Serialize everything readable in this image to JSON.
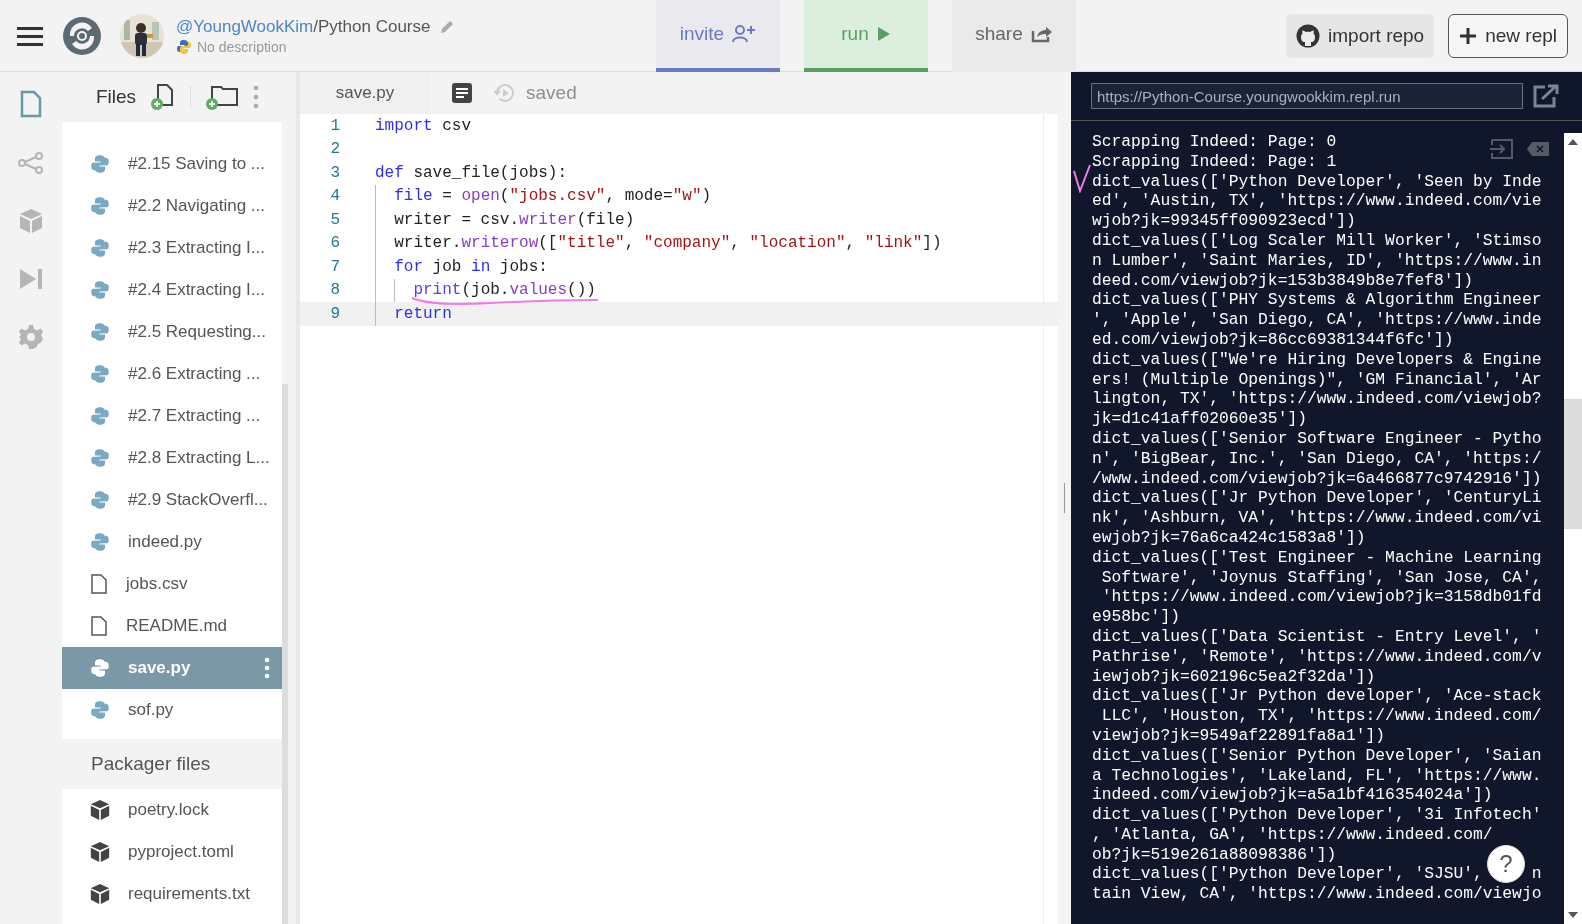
{
  "header": {
    "owner": "@YoungWookKim",
    "separator": "/",
    "project": "Python Course",
    "description": "No description"
  },
  "actions": [
    {
      "label": "invite",
      "kind": "invite"
    },
    {
      "label": "run",
      "kind": "run"
    },
    {
      "label": "share",
      "kind": "share"
    }
  ],
  "right_buttons": [
    {
      "label": "import repo",
      "kind": "github"
    },
    {
      "label": "new repl",
      "kind": "plus"
    }
  ],
  "rail": [
    {
      "kind": "file",
      "selected": true
    },
    {
      "kind": "share",
      "selected": false
    },
    {
      "kind": "cube",
      "selected": false
    },
    {
      "kind": "debug",
      "selected": false
    },
    {
      "kind": "gear",
      "selected": false
    }
  ],
  "files": {
    "title": "Files",
    "items": [
      {
        "name": "#2.15 Saving to ...",
        "kind": "python",
        "selected": false
      },
      {
        "name": "#2.2 Navigating ...",
        "kind": "python",
        "selected": false
      },
      {
        "name": "#2.3 Extracting I...",
        "kind": "python",
        "selected": false
      },
      {
        "name": "#2.4 Extracting I...",
        "kind": "python",
        "selected": false
      },
      {
        "name": "#2.5 Requesting...",
        "kind": "python",
        "selected": false
      },
      {
        "name": "#2.6 Extracting ...",
        "kind": "python",
        "selected": false
      },
      {
        "name": "#2.7 Extracting ...",
        "kind": "python",
        "selected": false
      },
      {
        "name": "#2.8 Extracting L...",
        "kind": "python",
        "selected": false
      },
      {
        "name": "#2.9 StackOverfl...",
        "kind": "python",
        "selected": false
      },
      {
        "name": "indeed.py",
        "kind": "python",
        "selected": false
      },
      {
        "name": "jobs.csv",
        "kind": "file",
        "selected": false
      },
      {
        "name": "README.md",
        "kind": "file",
        "selected": false
      },
      {
        "name": "save.py",
        "kind": "python",
        "selected": true
      },
      {
        "name": "sof.py",
        "kind": "python",
        "selected": false
      }
    ],
    "packager_title": "Packager files",
    "packager_items": [
      {
        "name": "poetry.lock"
      },
      {
        "name": "pyproject.toml"
      },
      {
        "name": "requirements.txt"
      }
    ]
  },
  "editor": {
    "tab": "save.py",
    "status": "saved",
    "lines": [
      {
        "number": "1",
        "tokens": [
          {
            "text": "import",
            "kind": "keyword"
          },
          {
            "text": " csv",
            "kind": "plain"
          }
        ]
      },
      {
        "number": "2"
      },
      {
        "number": "3",
        "tokens": [
          {
            "text": "def",
            "kind": "keyword"
          },
          {
            "text": " save_file(jobs):",
            "kind": "plain"
          }
        ],
        "children": [
          {
            "number": "4",
            "tokens": [
              {
                "text": "file",
                "kind": "keyword"
              },
              {
                "text": " = ",
                "kind": "plain"
              },
              {
                "text": "open",
                "kind": "function"
              },
              {
                "text": "(",
                "kind": "plain"
              },
              {
                "text": "\"jobs.csv\"",
                "kind": "string"
              },
              {
                "text": ", mode=",
                "kind": "plain"
              },
              {
                "text": "\"w\"",
                "kind": "string"
              },
              {
                "text": ")",
                "kind": "plain"
              }
            ]
          },
          {
            "number": "5",
            "tokens": [
              {
                "text": "writer = csv.",
                "kind": "plain"
              },
              {
                "text": "writer",
                "kind": "function"
              },
              {
                "text": "(file)",
                "kind": "plain"
              }
            ]
          },
          {
            "number": "6",
            "tokens": [
              {
                "text": "writer.",
                "kind": "plain"
              },
              {
                "text": "writerow",
                "kind": "function"
              },
              {
                "text": "([",
                "kind": "plain"
              },
              {
                "text": "\"title\"",
                "kind": "string"
              },
              {
                "text": ", ",
                "kind": "plain"
              },
              {
                "text": "\"company\"",
                "kind": "string"
              },
              {
                "text": ", ",
                "kind": "plain"
              },
              {
                "text": "\"location\"",
                "kind": "string"
              },
              {
                "text": ", ",
                "kind": "plain"
              },
              {
                "text": "\"link\"",
                "kind": "string"
              },
              {
                "text": "])",
                "kind": "plain"
              }
            ]
          },
          {
            "number": "7",
            "tokens": [
              {
                "text": "for",
                "kind": "keyword"
              },
              {
                "text": " job ",
                "kind": "plain"
              },
              {
                "text": "in",
                "kind": "keyword"
              },
              {
                "text": " jobs:",
                "kind": "plain"
              }
            ],
            "children": [
              {
                "number": "8",
                "tokens": [
                  {
                    "text": "print",
                    "kind": "builtin"
                  },
                  {
                    "text": "(job.",
                    "kind": "plain"
                  },
                  {
                    "text": "values",
                    "kind": "function"
                  },
                  {
                    "text": "())",
                    "kind": "plain"
                  }
                ]
              }
            ]
          },
          {
            "number": "9",
            "current": true,
            "tokens": [
              {
                "text": "return",
                "kind": "keyword"
              }
            ]
          }
        ]
      }
    ]
  },
  "console": {
    "url": "https://Python-Course.youngwookkim.repl.run",
    "lines": [
      {
        "text": "Scrapping Indeed: Page: 0"
      },
      {
        "text": "Scrapping Indeed: Page: 1"
      },
      {
        "text": "dict_values(['Python Developer', 'Seen by Inde"
      },
      {
        "text": "ed', 'Austin, TX', 'https://www.indeed.com/vie"
      },
      {
        "text": "wjob?jk=99345ff090923ecd'])"
      },
      {
        "text": "dict_values(['Log Scaler Mill Worker', 'Stimso"
      },
      {
        "text": "n Lumber', 'Saint Maries, ID', 'https://www.in"
      },
      {
        "text": "deed.com/viewjob?jk=153b3849b8e7fef8'])"
      },
      {
        "text": "dict_values(['PHY Systems & Algorithm Engineer"
      },
      {
        "text": "', 'Apple', 'San Diego, CA', 'https://www.inde"
      },
      {
        "text": "ed.com/viewjob?jk=86cc69381344f6fc'])"
      },
      {
        "text": "dict_values([\"We're Hiring Developers & Engine"
      },
      {
        "text": "ers! (Multiple Openings)\", 'GM Financial', 'Ar"
      },
      {
        "text": "lington, TX', 'https://www.indeed.com/viewjob?"
      },
      {
        "text": "jk=d1c41aff02060e35'])"
      },
      {
        "text": "dict_values(['Senior Software Engineer - Pytho"
      },
      {
        "text": "n', 'BigBear, Inc.', 'San Diego, CA', 'https:/"
      },
      {
        "text": "/www.indeed.com/viewjob?jk=6a466877c9742916'])"
      },
      {
        "text": "dict_values(['Jr Python Developer', 'CenturyLi"
      },
      {
        "text": "nk', 'Ashburn, VA', 'https://www.indeed.com/vi"
      },
      {
        "text": "ewjob?jk=76a6ca424c1583a8'])"
      },
      {
        "text": "dict_values(['Test Engineer - Machine Learning"
      },
      {
        "text": " Software', 'Joynus Staffing', 'San Jose, CA',"
      },
      {
        "text": " 'https://www.indeed.com/viewjob?jk=3158db01fd"
      },
      {
        "text": "e958bc'])"
      },
      {
        "text": "dict_values(['Data Scientist - Entry Level', '"
      },
      {
        "text": "Pathrise', 'Remote', 'https://www.indeed.com/v"
      },
      {
        "text": "iewjob?jk=602196c5ea2f32da'])"
      },
      {
        "text": "dict_values(['Jr Python developer', 'Ace-stack"
      },
      {
        "text": " LLC', 'Houston, TX', 'https://www.indeed.com/"
      },
      {
        "text": "viewjob?jk=9549af22891fa8a1'])"
      },
      {
        "text": "dict_values(['Senior Python Developer', 'Saian"
      },
      {
        "text": "a Technologies', 'Lakeland, FL', 'https://www."
      },
      {
        "text": "indeed.com/viewjob?jk=a5a1bf416354024a'])"
      },
      {
        "text": "dict_values(['Python Developer', '3i Infotech'"
      },
      {
        "text": ", 'Atlanta, GA', 'https://www.indeed.com/"
      },
      {
        "text": "ob?jk=519e261a88098386'])"
      },
      {
        "text": "dict_values(['Python Developer', 'SJSU',",
        "tail": "n"
      },
      {
        "text": "tain View, CA', 'https://www.indeed.com/viewjo"
      }
    ],
    "help": "?"
  }
}
